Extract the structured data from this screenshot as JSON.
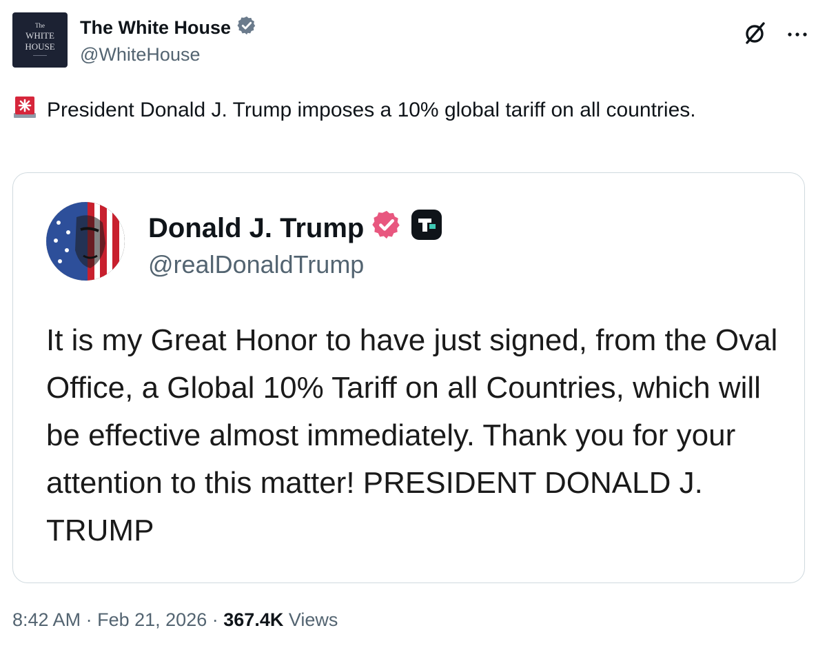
{
  "post": {
    "author": {
      "name": "The White House",
      "handle": "@WhiteHouse",
      "avatar_text_top": "WHITE",
      "avatar_text_bottom": "HOUSE"
    },
    "text": "President Donald J. Trump imposes a 10% global tariff on all countries.",
    "icons": {
      "verified": "verified-badge-gray-icon",
      "grok": "grok-slash-icon",
      "more": "more-options-icon",
      "siren": "rotating-light-emoji-icon"
    }
  },
  "quote": {
    "author": {
      "name": "Donald J. Trump",
      "handle": "@realDonaldTrump"
    },
    "text": "It is my Great Honor to have just signed, from the Oval Office, a Global 10% Tariff on all Countries, which will be effective almost immediately. Thank you for your attention to this matter! PRESIDENT DONALD J. TRUMP",
    "icons": {
      "verified": "verified-badge-pink-icon",
      "platform": "truth-social-icon"
    }
  },
  "meta": {
    "time": "8:42 AM",
    "sep": "·",
    "date": "Feb 21, 2026",
    "views_count": "367.4K",
    "views_label": "Views"
  },
  "colors": {
    "text": "#0f1419",
    "muted": "#536471",
    "border": "#cfd9de",
    "badge_gray": "#6b7b8c",
    "badge_pink": "#e8577f",
    "siren_red": "#d6263b"
  }
}
